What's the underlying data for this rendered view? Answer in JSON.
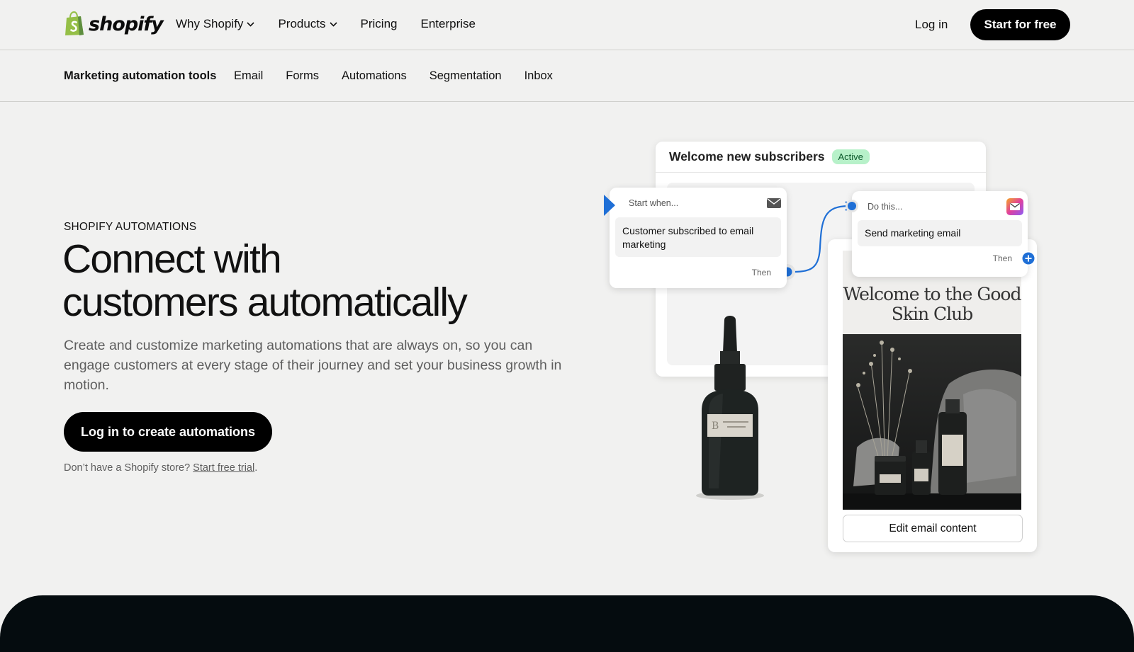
{
  "brand": {
    "name": "shopify",
    "accent": "#95bf47"
  },
  "topnav": {
    "items": [
      {
        "label": "Why Shopify",
        "has_dropdown": true
      },
      {
        "label": "Products",
        "has_dropdown": true
      },
      {
        "label": "Pricing",
        "has_dropdown": false
      },
      {
        "label": "Enterprise",
        "has_dropdown": false
      }
    ],
    "login_label": "Log in",
    "start_label": "Start for free"
  },
  "subnav": {
    "title": "Marketing automation tools",
    "items": [
      "Email",
      "Forms",
      "Automations",
      "Segmentation",
      "Inbox"
    ]
  },
  "hero": {
    "eyebrow": "SHOPIFY AUTOMATIONS",
    "title_line1": "Connect with",
    "title_line2": "customers automatically",
    "description": "Create and customize marketing automations that are always on, so you can engage customers at every stage of their journey and set your business growth in motion.",
    "cta_label": "Log in to create automations",
    "trial_prefix": "Don’t have a Shopify store? ",
    "trial_link": "Start free trial",
    "trial_suffix": "."
  },
  "illustration": {
    "workflow_title": "Welcome new subscribers",
    "workflow_status": "Active",
    "trigger": {
      "header": "Start when...",
      "body": "Customer subscribed to email marketing",
      "then": "Then",
      "icon": "envelope-icon"
    },
    "action": {
      "header": "Do this...",
      "body": "Send marketing email",
      "then": "Then",
      "icon": "marketing-email-icon"
    },
    "email_preview": {
      "headline": "Welcome to the Good Skin Club",
      "edit_label": "Edit email content"
    },
    "connector_color": "#1f6fd6",
    "status_color": "#b7f1c9"
  }
}
